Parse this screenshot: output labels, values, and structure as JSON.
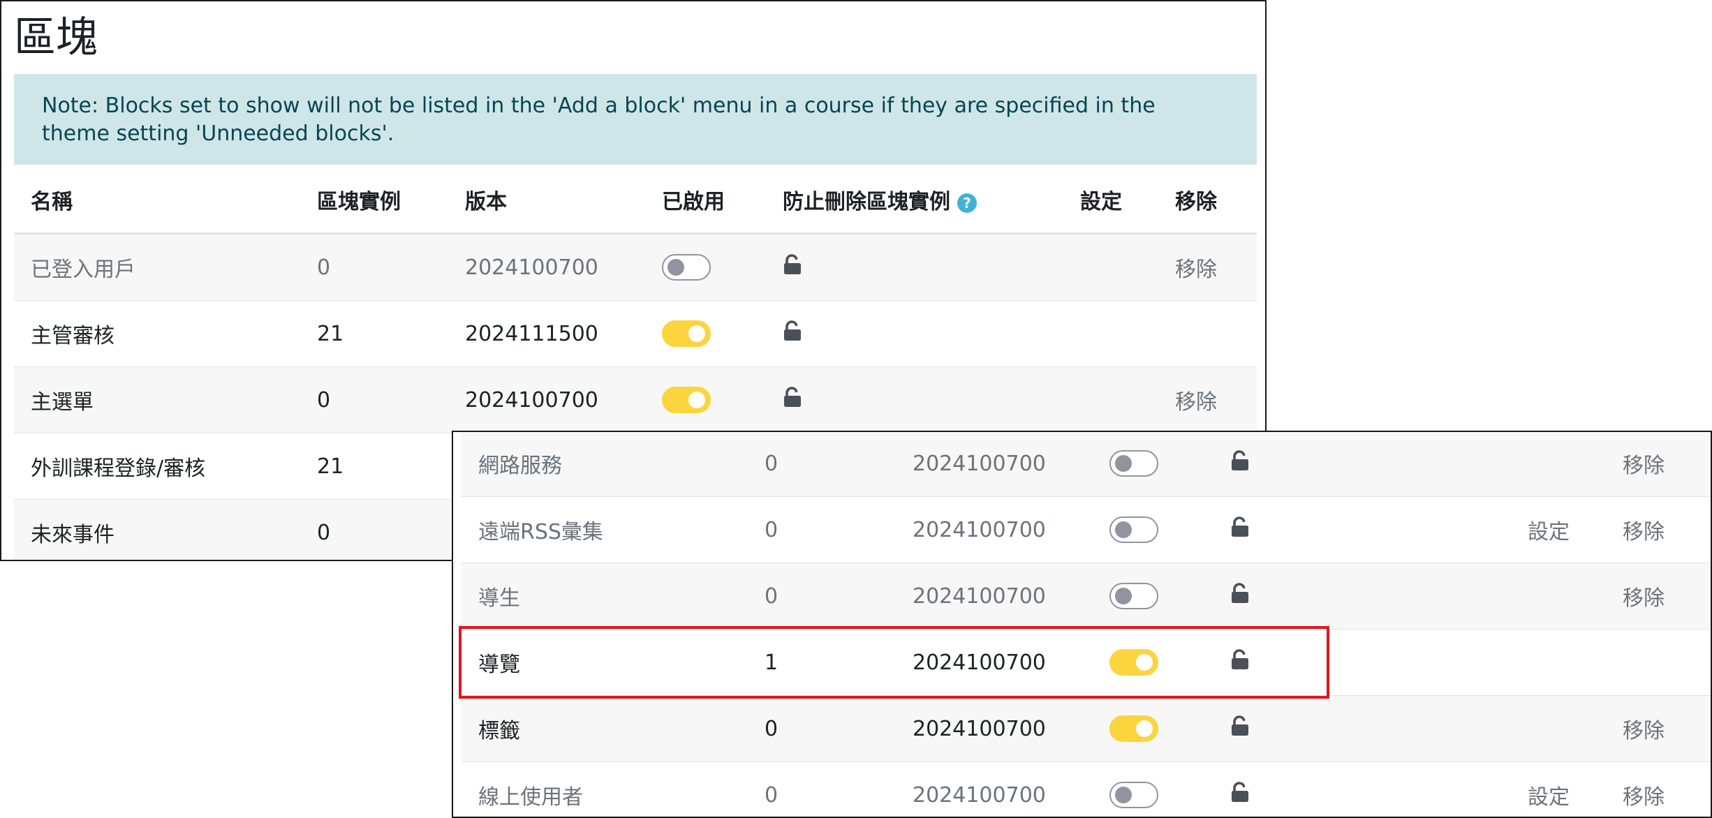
{
  "page": {
    "title": "區塊",
    "notice": "Note: Blocks set to show will not be listed in the 'Add a block' menu in a course if they are specified in the theme setting 'Unneeded blocks'."
  },
  "table": {
    "headers": {
      "name": "名稱",
      "instances": "區塊實例",
      "version": "版本",
      "enabled": "已啟用",
      "protect": "防止刪除區塊實例",
      "settings": "設定",
      "uninstall": "移除"
    },
    "help_glyph": "?"
  },
  "main_rows": [
    {
      "name": "已登入用戶",
      "instances": "0",
      "version": "2024100700",
      "enabled": false,
      "settings": "",
      "uninstall": "移除"
    },
    {
      "name": "主管審核",
      "instances": "21",
      "version": "2024111500",
      "enabled": true,
      "settings": "",
      "uninstall": ""
    },
    {
      "name": "主選單",
      "instances": "0",
      "version": "2024100700",
      "enabled": true,
      "settings": "",
      "uninstall": "移除"
    },
    {
      "name": "外訓課程登錄/審核",
      "instances": "21",
      "version": "",
      "enabled": null,
      "settings": "",
      "uninstall": ""
    },
    {
      "name": "未來事件",
      "instances": "0",
      "version": "",
      "enabled": null,
      "settings": "",
      "uninstall": ""
    }
  ],
  "zoom_rows": [
    {
      "name": "網路服務",
      "instances": "0",
      "version": "2024100700",
      "enabled": false,
      "settings": "",
      "uninstall": "移除"
    },
    {
      "name": "遠端RSS彙集",
      "instances": "0",
      "version": "2024100700",
      "enabled": false,
      "settings": "設定",
      "uninstall": "移除"
    },
    {
      "name": "導生",
      "instances": "0",
      "version": "2024100700",
      "enabled": false,
      "settings": "",
      "uninstall": "移除"
    },
    {
      "name": "導覽",
      "instances": "1",
      "version": "2024100700",
      "enabled": true,
      "settings": "",
      "uninstall": ""
    },
    {
      "name": "標籤",
      "instances": "0",
      "version": "2024100700",
      "enabled": true,
      "settings": "",
      "uninstall": "移除"
    },
    {
      "name": "線上使用者",
      "instances": "0",
      "version": "2024100700",
      "enabled": false,
      "settings": "設定",
      "uninstall": "移除"
    }
  ],
  "colors": {
    "toggle_on": "#fcd43d",
    "toggle_off": "#8f959e",
    "notice_bg": "#cfe6e9",
    "notice_text": "#064552",
    "highlight": "#e0161e",
    "lock": "#495057"
  },
  "icons": {
    "lock": "lock-open-icon",
    "help": "help-icon"
  }
}
